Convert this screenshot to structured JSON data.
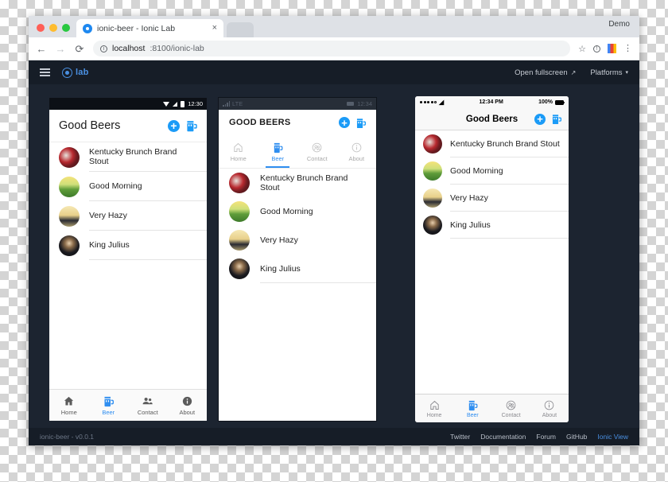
{
  "browser": {
    "tab": {
      "title": "ionic-beer - Ionic Lab",
      "close": "×",
      "favicon": "ionic-favicon"
    },
    "demo_label": "Demo",
    "nav": {
      "back": "←",
      "forward": "→",
      "reload": "⟳"
    },
    "url": {
      "host": "localhost",
      "path": ":8100/ionic-lab",
      "full": "localhost:8100/ionic-lab"
    },
    "star": "☆",
    "kebab": "⋮"
  },
  "lab": {
    "logo_text": "lab",
    "fullscreen_label": "Open fullscreen",
    "fullscreen_icon": "↗",
    "platforms_label": "Platforms",
    "platforms_caret": "▾",
    "footer": {
      "version": "ionic-beer - v0.0.1",
      "links": [
        {
          "label": "Twitter",
          "accent": false
        },
        {
          "label": "Documentation",
          "accent": false
        },
        {
          "label": "Forum",
          "accent": false
        },
        {
          "label": "GitHub",
          "accent": false
        },
        {
          "label": "Ionic View",
          "accent": true
        }
      ]
    }
  },
  "beers": [
    {
      "name": "Kentucky Brunch Brand Stout",
      "avatar": "av-0"
    },
    {
      "name": "Good Morning",
      "avatar": "av-1"
    },
    {
      "name": "Very Hazy",
      "avatar": "av-2"
    },
    {
      "name": "King Julius",
      "avatar": "av-3"
    }
  ],
  "tabs": [
    {
      "label": "Home",
      "icon": "home-icon",
      "active": false
    },
    {
      "label": "Beer",
      "icon": "beer-mug-icon",
      "active": true
    },
    {
      "label": "Contact",
      "icon": "contacts-icon",
      "active": false
    },
    {
      "label": "About",
      "icon": "info-icon",
      "active": false
    }
  ],
  "devices": {
    "android": {
      "platform": "android",
      "status": {
        "time": "12:30",
        "wifi": "wifi-icon",
        "signal": "signal-icon",
        "battery": "battery-icon"
      },
      "title": "Good Beers",
      "actions": {
        "add": "add-icon",
        "beer": "beer-mug-icon"
      }
    },
    "windows": {
      "platform": "windows",
      "status": {
        "network": "LTE",
        "time": "12:34",
        "battery": "battery-icon"
      },
      "title": "GOOD BEERS",
      "actions": {
        "add": "add-icon",
        "beer": "beer-mug-icon"
      }
    },
    "ios": {
      "platform": "ios",
      "status": {
        "signal": "●●●●○",
        "wifi": "wifi-icon",
        "time": "12:34 PM",
        "battery_pct": "100%"
      },
      "title": "Good Beers",
      "actions": {
        "add": "add-icon",
        "beer": "beer-mug-icon"
      }
    }
  },
  "colors": {
    "accent": "#2f8ef0",
    "lab_bg": "#1c2430",
    "lab_chrome": "#161d27"
  }
}
